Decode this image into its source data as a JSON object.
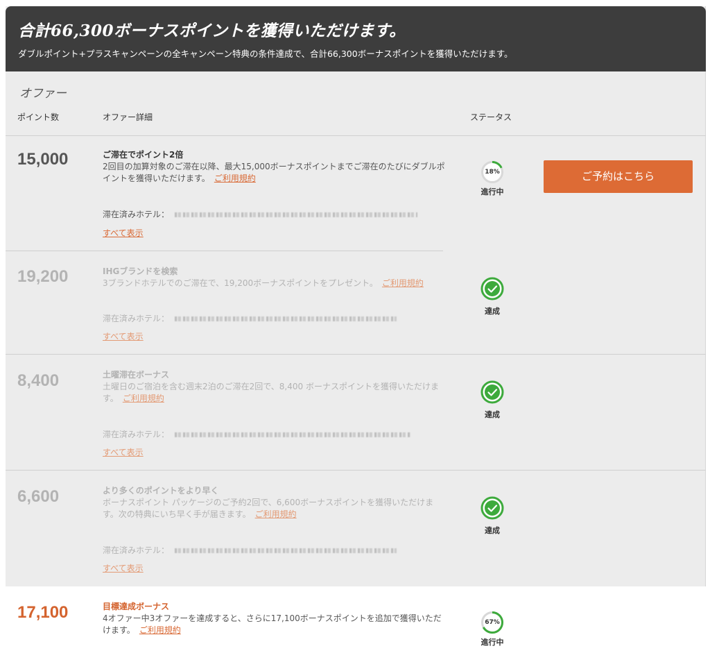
{
  "header": {
    "title": "合計66,300ボーナスポイントを獲得いただけます。",
    "subtitle": "ダブルポイント+プラスキャンペーンの全キャンペーン特典の条件達成で、合計66,300ボーナスポイントを獲得いただけます。"
  },
  "section_title": "オファー",
  "columns": {
    "points": "ポイント数",
    "details": "オファー詳細",
    "status": "ステータス"
  },
  "book_button": "ご予約はこちら",
  "colors": {
    "accent": "#dd6b35",
    "success": "#3daa3c",
    "header_bg": "#3d3d3d"
  },
  "offers": [
    {
      "points": "15,000",
      "title": "ご滞在でポイント2倍",
      "desc": "2回目の加算対象のご滞在以降、最大15,000ボーナスポイントまでご滞在のたびにダブルポイントを獲得いただけます。",
      "tos": "ご利用規約",
      "stayed_label": "滞在済みホテル：",
      "show_all": "すべて表示",
      "status": "進行中",
      "progress_text": "18%",
      "progress": 0.18
    },
    {
      "points": "19,200",
      "title": "IHGブランドを検索",
      "desc": "3ブランドホテルでのご滞在で、19,200ボーナスポイントをプレゼント。",
      "tos": "ご利用規約",
      "stayed_label": "滞在済みホテル：",
      "show_all": "すべて表示",
      "status": "達成"
    },
    {
      "points": "8,400",
      "title": "土曜滞在ボーナス",
      "desc": "土曜日のご宿泊を含む週末2泊のご滞在2回で、8,400 ボーナスポイントを獲得いただけます。",
      "tos": "ご利用規約",
      "stayed_label": "滞在済みホテル：",
      "show_all": "すべて表示",
      "status": "達成"
    },
    {
      "points": "6,600",
      "title": "より多くのポイントをより早く",
      "desc": "ボーナスポイント パッケージのご予約2回で、6,600ボーナスポイントを獲得いただけます。次の特典にいち早く手が届きます。",
      "tos": "ご利用規約",
      "stayed_label": "滞在済みホテル：",
      "show_all": "すべて表示",
      "status": "達成"
    },
    {
      "points": "17,100",
      "title": "目標達成ボーナス",
      "desc": "4オファー中3オファーを達成すると、さらに17,100ボーナスポイントを追加で獲得いただけます。",
      "tos": "ご利用規約",
      "status": "進行中",
      "progress_text": "67%",
      "progress": 0.67
    }
  ]
}
